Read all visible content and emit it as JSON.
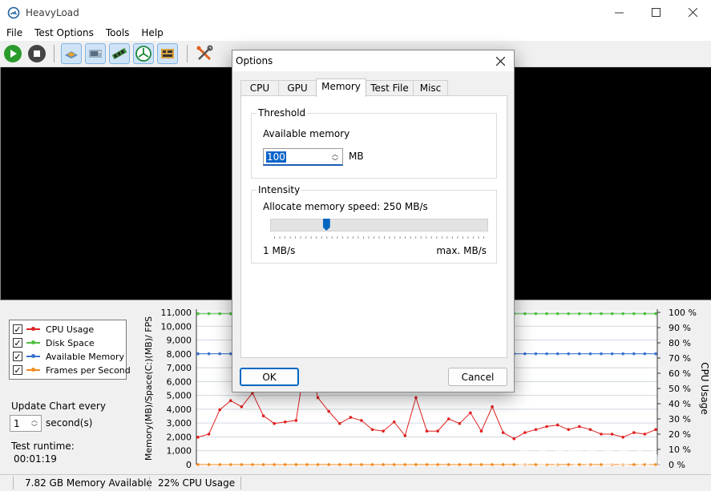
{
  "window": {
    "title": "HeavyLoad",
    "icon": "gauge-icon"
  },
  "menu": [
    "File",
    "Test Options",
    "Tools",
    "Help"
  ],
  "toolbar": {
    "buttons": [
      {
        "name": "start-test-button",
        "icon": "play-icon",
        "color": "#2a9a2a"
      },
      {
        "name": "stop-test-button",
        "icon": "stop-icon",
        "color": "#4a4a4a"
      },
      {
        "name": "cpu-test-toggle",
        "icon": "cpu-chip-icon",
        "pressed": true
      },
      {
        "name": "gpu-test-toggle",
        "icon": "gpu-card-icon",
        "pressed": true
      },
      {
        "name": "memory-test-toggle",
        "icon": "memory-stick-icon",
        "pressed": true
      },
      {
        "name": "disk-test-toggle",
        "icon": "tree-size-icon",
        "pressed": true
      },
      {
        "name": "test-file-toggle",
        "icon": "circuit-board-icon",
        "pressed": true
      },
      {
        "name": "options-button",
        "icon": "tools-icon",
        "pressed": false
      }
    ]
  },
  "legend": {
    "items": [
      {
        "label": "CPU Usage",
        "color": "#e02020",
        "checked": true
      },
      {
        "label": "Disk Space",
        "color": "#50c040",
        "checked": true
      },
      {
        "label": "Available Memory",
        "color": "#3a70d0",
        "checked": true
      },
      {
        "label": "Frames per Second",
        "color": "#f08a20",
        "checked": true
      }
    ]
  },
  "update": {
    "label": "Update Chart every",
    "value": "1",
    "unit": "second(s)"
  },
  "runtime": {
    "label": "Test runtime:",
    "value": "00:01:19"
  },
  "chart_data": {
    "type": "line",
    "ylabel": "Memory(MB)/Space(C:)(MB)/ FPS",
    "y2label": "CPU Usage",
    "ylim": [
      0,
      11000
    ],
    "y2lim": [
      0,
      100
    ],
    "yticks": [
      "11,000",
      "10,000",
      "9,000",
      "8,000",
      "7,000",
      "6,000",
      "5,000",
      "4,000",
      "3,000",
      "2,000",
      "1,000",
      "0"
    ],
    "y2ticks": [
      "100 %",
      "90 %",
      "80 %",
      "70 %",
      "60 %",
      "50 %",
      "40 %",
      "30 %",
      "20 %",
      "10 %",
      "0 %"
    ],
    "grid": true,
    "series": [
      {
        "name": "CPU Usage",
        "color": "#e02020",
        "axis": "right",
        "values": [
          18,
          20,
          36,
          42,
          38,
          47,
          32,
          27,
          28,
          29,
          75,
          44,
          35,
          27,
          31,
          29,
          23,
          22,
          28,
          19,
          44,
          22,
          22,
          30,
          27,
          34,
          22,
          38,
          21,
          17,
          21,
          23,
          25,
          26,
          23,
          25,
          23,
          20,
          20,
          18,
          21,
          20,
          23
        ]
      },
      {
        "name": "Disk Space",
        "color": "#50c040",
        "axis": "left",
        "values": [
          10900,
          10900,
          10900,
          10900,
          10900,
          10900,
          10900,
          10900,
          10900,
          10900,
          10900,
          10900,
          10900,
          10900,
          10900,
          10900,
          10900,
          10900,
          10900,
          10900,
          10900,
          10900,
          10900,
          10900,
          10900,
          10900,
          10900,
          10900,
          10900,
          10900,
          10900,
          10900,
          10900,
          10900,
          10900,
          10900,
          10900,
          10900,
          10900,
          10900,
          10900,
          10900,
          10900
        ]
      },
      {
        "name": "Available Memory",
        "color": "#3a70d0",
        "axis": "left",
        "values": [
          8010,
          8010,
          8010,
          8010,
          8010,
          8010,
          8010,
          8010,
          8010,
          8010,
          8010,
          8010,
          8010,
          8010,
          8010,
          8010,
          8010,
          8010,
          8010,
          8010,
          8010,
          8010,
          8010,
          8010,
          8010,
          8010,
          8010,
          8010,
          8010,
          8010,
          8010,
          8010,
          8010,
          8010,
          8010,
          8010,
          8010,
          8010,
          8010,
          8010,
          8010,
          8010,
          8010
        ]
      },
      {
        "name": "Frames per Second",
        "color": "#f08a20",
        "axis": "left",
        "values": [
          0,
          0,
          0,
          0,
          0,
          0,
          0,
          0,
          0,
          0,
          0,
          0,
          0,
          0,
          0,
          0,
          0,
          0,
          0,
          0,
          0,
          0,
          0,
          0,
          0,
          0,
          0,
          0,
          0,
          0,
          0,
          0,
          0,
          0,
          0,
          0,
          0,
          0,
          0,
          0,
          0,
          0,
          0
        ]
      }
    ]
  },
  "status": {
    "memory": "7.82 GB Memory Available",
    "cpu": "22% CPU Usage"
  },
  "watermark": "SOFTPEDIA",
  "dialog": {
    "title": "Options",
    "tabs": [
      "CPU",
      "GPU",
      "Memory",
      "Test File",
      "Misc"
    ],
    "active_tab": "Memory",
    "threshold": {
      "group": "Threshold",
      "label": "Available memory",
      "value": "100",
      "unit": "MB"
    },
    "intensity": {
      "group": "Intensity",
      "label": "Allocate memory speed: 250 MB/s",
      "min_label": "1 MB/s",
      "max_label": "max. MB/s",
      "position": 0.25
    },
    "ok": "OK",
    "cancel": "Cancel"
  }
}
